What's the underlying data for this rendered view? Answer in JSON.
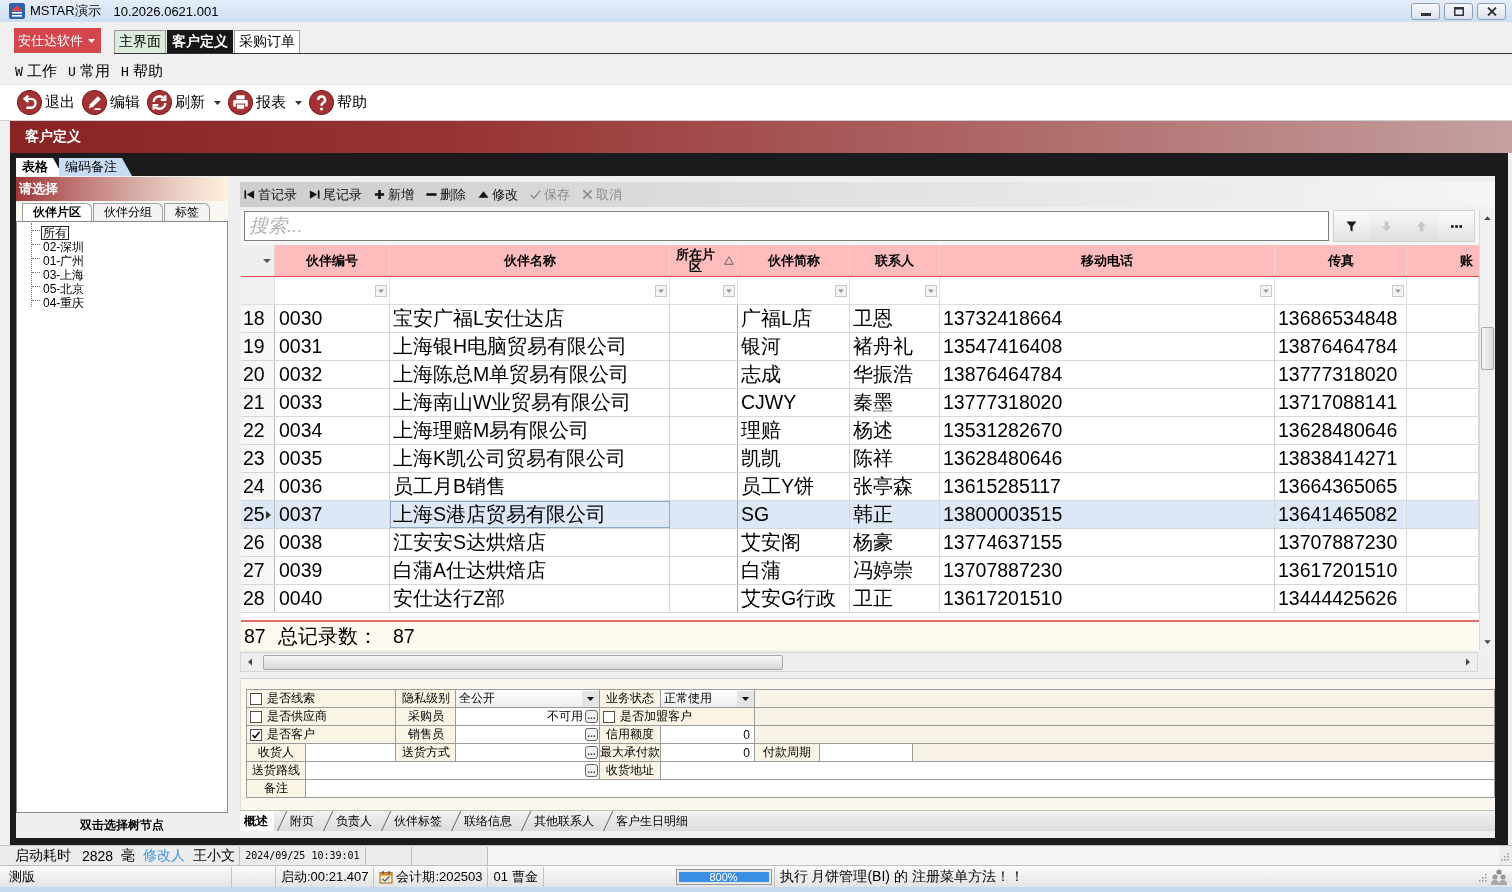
{
  "window": {
    "title": "MSTAR演示",
    "version": "10.2026.0621.001"
  },
  "app_menu": {
    "label": "安仕达软件"
  },
  "document_tabs": [
    {
      "label": "主界面",
      "kind": "home",
      "selected": false
    },
    {
      "label": "客户定义",
      "kind": "document",
      "selected": true
    },
    {
      "label": "采购订单",
      "kind": "document",
      "selected": false
    }
  ],
  "menu_bar": [
    {
      "key": "W",
      "label": "工作"
    },
    {
      "key": "U",
      "label": "常用"
    },
    {
      "key": "H",
      "label": "帮助"
    }
  ],
  "toolbar": [
    {
      "kind": "exit",
      "label": "退出",
      "dropdown": false
    },
    {
      "kind": "edit",
      "label": "编辑",
      "dropdown": false
    },
    {
      "kind": "refresh",
      "label": "刷新",
      "dropdown": true
    },
    {
      "kind": "print",
      "label": "报表",
      "dropdown": true
    },
    {
      "kind": "help",
      "label": "帮助",
      "dropdown": false
    }
  ],
  "page_header": {
    "title": "客户定义"
  },
  "view_tabs": [
    {
      "label": "表格",
      "selected": true
    },
    {
      "label": "编码备注",
      "selected": false
    }
  ],
  "picker": {
    "title": "请选择",
    "tabs": [
      {
        "label": "伙伴片区",
        "selected": true
      },
      {
        "label": "伙伴分组",
        "selected": false
      },
      {
        "label": "标签",
        "selected": false
      }
    ],
    "tree": [
      {
        "label": "所有",
        "selected": true
      },
      {
        "label": "02-深圳",
        "selected": false
      },
      {
        "label": "01-广州",
        "selected": false
      },
      {
        "label": "03-上海",
        "selected": false
      },
      {
        "label": "05-北京",
        "selected": false
      },
      {
        "label": "04-重庆",
        "selected": false
      }
    ],
    "hint": "双击选择树节点"
  },
  "record_toolbar": [
    {
      "kind": "first",
      "label": "首记录",
      "disabled": false
    },
    {
      "kind": "last",
      "label": "尾记录",
      "disabled": false
    },
    {
      "kind": "add",
      "label": "新增",
      "disabled": false
    },
    {
      "kind": "delete",
      "label": "删除",
      "disabled": false
    },
    {
      "kind": "edit",
      "label": "修改",
      "disabled": false
    },
    {
      "kind": "save",
      "label": "保存",
      "disabled": true
    },
    {
      "kind": "cancel",
      "label": "取消",
      "disabled": true
    }
  ],
  "search": {
    "placeholder": "搜索...",
    "buttons": [
      {
        "kind": "filter",
        "disabled": false
      },
      {
        "kind": "down",
        "disabled": true
      },
      {
        "kind": "up",
        "disabled": true
      },
      {
        "kind": "more",
        "disabled": false
      }
    ]
  },
  "table": {
    "columns": [
      {
        "label": "伙伴编号",
        "sorted": false
      },
      {
        "label": "伙伴名称",
        "sorted": false
      },
      {
        "label": "所在片区",
        "sorted": true
      },
      {
        "label": "伙伴简称",
        "sorted": false
      },
      {
        "label": "联系人",
        "sorted": false
      },
      {
        "label": "移动电话",
        "sorted": false
      },
      {
        "label": "传真",
        "sorted": false
      },
      {
        "label": "账",
        "sorted": false
      }
    ],
    "rows": [
      {
        "number": "18",
        "code": "0030",
        "name": "宝安广福L安仕达店",
        "short_name": "广福L店",
        "contact": "卫恩",
        "mobile": "13732418664",
        "fax": "13686534848",
        "selected": false
      },
      {
        "number": "19",
        "code": "0031",
        "name": "上海银H电脑贸易有限公司",
        "short_name": "银河",
        "contact": "褚舟礼",
        "mobile": "13547416408",
        "fax": "13876464784",
        "selected": false
      },
      {
        "number": "20",
        "code": "0032",
        "name": "上海陈总M单贸易有限公司",
        "short_name": "志成",
        "contact": "华振浩",
        "mobile": "13876464784",
        "fax": "13777318020",
        "selected": false
      },
      {
        "number": "21",
        "code": "0033",
        "name": "上海南山W业贸易有限公司",
        "short_name": "CJWY",
        "contact": "秦墨",
        "mobile": "13777318020",
        "fax": "13717088141",
        "selected": false
      },
      {
        "number": "22",
        "code": "0034",
        "name": "上海理赔M易有限公司",
        "short_name": "理赔",
        "contact": "杨述",
        "mobile": "13531282670",
        "fax": "13628480646",
        "selected": false
      },
      {
        "number": "23",
        "code": "0035",
        "name": "上海K凯公司贸易有限公司",
        "short_name": "凯凯",
        "contact": "陈祥",
        "mobile": "13628480646",
        "fax": "13838414271",
        "selected": false
      },
      {
        "number": "24",
        "code": "0036",
        "name": "员工月B销售",
        "short_name": "员工Y饼",
        "contact": "张亭森",
        "mobile": "13615285117",
        "fax": "13664365065",
        "selected": false
      },
      {
        "number": "25",
        "code": "0037",
        "name": "上海S港店贸易有限公司",
        "short_name": "SG",
        "contact": "韩正",
        "mobile": "13800003515",
        "fax": "13641465082",
        "selected": true
      },
      {
        "number": "26",
        "code": "0038",
        "name": "江安安S达烘焙店",
        "short_name": "艾安阁",
        "contact": "杨豪",
        "mobile": "13774637155",
        "fax": "13707887230",
        "selected": false
      },
      {
        "number": "27",
        "code": "0039",
        "name": "白蒲A仕达烘焙店",
        "short_name": "白蒲",
        "contact": "冯婷崇",
        "mobile": "13707887230",
        "fax": "13617201510",
        "selected": false
      },
      {
        "number": "28",
        "code": "0040",
        "name": "安仕达行Z部",
        "short_name": "艾安G行政",
        "contact": "卫正",
        "mobile": "13617201510",
        "fax": "13444425626",
        "selected": false
      }
    ],
    "footer": {
      "count_cell": "87",
      "label": "总记录数：",
      "value": "87"
    }
  },
  "detail_form": {
    "fields": [
      {
        "kind": "checkbox",
        "label": "是否线索",
        "checked": false
      },
      {
        "kind": "select",
        "label": "隐私级别",
        "value": "全公开"
      },
      {
        "kind": "select",
        "label": "业务状态",
        "value": "正常使用"
      },
      {
        "kind": "checkbox",
        "label": "是否供应商",
        "checked": false
      },
      {
        "kind": "lookup",
        "label": "采购员",
        "value": "不可用"
      },
      {
        "kind": "checkbox",
        "label": "是否加盟客户",
        "checked": false
      },
      {
        "kind": "checkbox",
        "label": "是否客户",
        "checked": true
      },
      {
        "kind": "lookup",
        "label": "销售员"
      },
      {
        "kind": "number",
        "label": "信用额度",
        "value": "0"
      },
      {
        "kind": "text",
        "label": "收货人"
      },
      {
        "kind": "lookup",
        "label": "送货方式"
      },
      {
        "kind": "number",
        "label": "最大承付款",
        "value": "0"
      },
      {
        "kind": "text",
        "label": "付款周期"
      },
      {
        "kind": "lookup",
        "label": "送货路线"
      },
      {
        "kind": "text",
        "label": "收货地址"
      },
      {
        "kind": "text",
        "label": "备注"
      }
    ]
  },
  "detail_tabs": [
    {
      "label": "概述",
      "selected": true
    },
    {
      "label": "附页",
      "selected": false
    },
    {
      "label": "负责人",
      "selected": false
    },
    {
      "label": "伙伴标签",
      "selected": false
    },
    {
      "label": "联络信息",
      "selected": false
    },
    {
      "label": "其他联系人",
      "selected": false
    },
    {
      "label": "客户生日明细",
      "selected": false
    }
  ],
  "status_bar": {
    "startup_label": "启动耗时",
    "startup_value": "2828",
    "startup_unit": "毫",
    "editor_label": "修改人",
    "editor": "王小文",
    "modified_at": "2024/09/25 10:39:01"
  },
  "info_bar": {
    "edition": "测版",
    "uptime": "启动:00:21.407",
    "period": "会计期:202503",
    "user": "01 曹金",
    "progress": {
      "level": 1,
      "label": "800%"
    },
    "message": "执行 月饼管理(BI) 的 注册菜单方法！！"
  }
}
